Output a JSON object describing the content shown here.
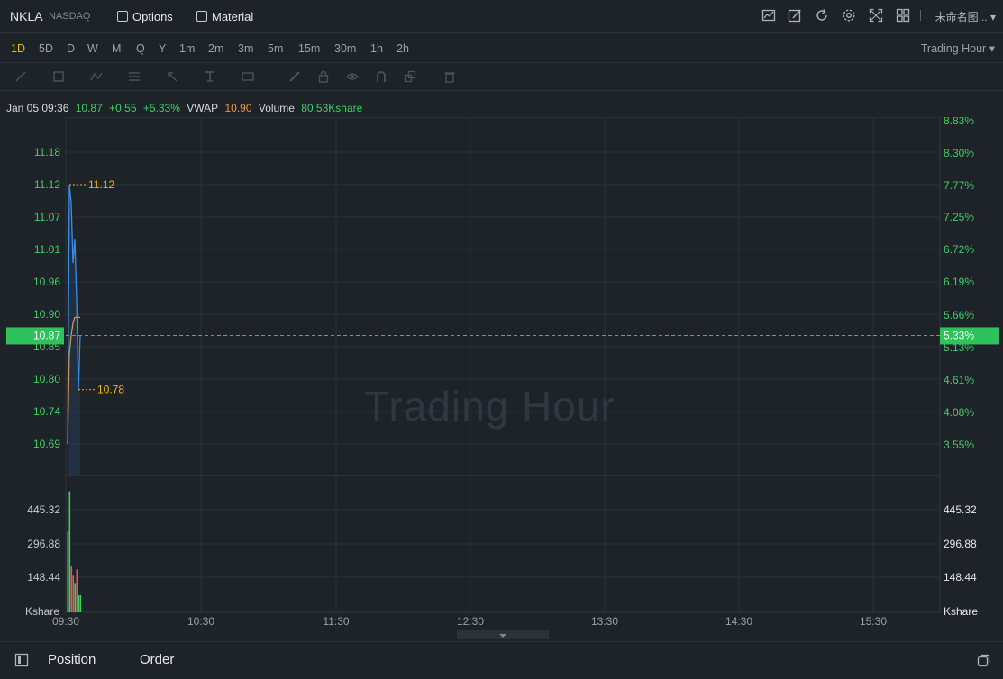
{
  "header": {
    "symbol": "NKLA",
    "exchange": "NASDAQ",
    "options_label": "Options",
    "material_label": "Material",
    "layout_name": "未命名图..."
  },
  "intervals": {
    "items": [
      "1D",
      "5D",
      "D",
      "W",
      "M",
      "Q",
      "Y",
      "1m",
      "2m",
      "3m",
      "5m",
      "15m",
      "30m",
      "1h",
      "2h"
    ],
    "active": "1D",
    "session_label": "Trading Hour"
  },
  "legend": {
    "datetime": "Jan 05 09:36",
    "price": "10.87",
    "change": "+0.55",
    "change_pct": "+5.33%",
    "vwap_label": "VWAP",
    "vwap_value": "10.90",
    "volume_label": "Volume",
    "volume_value": "80.53Kshare"
  },
  "watermark": "Trading Hour",
  "colors": {
    "up": "#3fcf63",
    "down": "#e05a5a",
    "price_line": "#3a8ee6",
    "vwap_line": "#e89a3c",
    "highlight": "#2fc25b",
    "marker": "#f0b90b"
  },
  "chart_data": {
    "type": "line",
    "price_axis_left": [
      "11.18",
      "11.12",
      "11.07",
      "11.01",
      "10.96",
      "10.90",
      "10.85",
      "10.80",
      "10.74",
      "10.69"
    ],
    "pct_axis_right": [
      "8.83%",
      "8.30%",
      "7.77%",
      "7.25%",
      "6.72%",
      "6.19%",
      "5.66%",
      "5.13%",
      "4.61%",
      "4.08%",
      "3.55%"
    ],
    "current_price_label": "10.87",
    "current_pct_label": "5.33%",
    "high_label": "11.12",
    "low_label": "10.78",
    "volume_axis": [
      "445.32",
      "296.88",
      "148.44"
    ],
    "volume_unit": "Kshare",
    "x_ticks": [
      "09:30",
      "10:30",
      "11:30",
      "12:30",
      "13:30",
      "14:30",
      "15:30"
    ],
    "ylim": [
      10.65,
      11.23
    ],
    "price": [
      {
        "t": 0,
        "v": 10.69
      },
      {
        "t": 1,
        "v": 11.12
      },
      {
        "t": 2,
        "v": 11.09
      },
      {
        "t": 3,
        "v": 10.99
      },
      {
        "t": 4,
        "v": 11.03
      },
      {
        "t": 5,
        "v": 10.93
      },
      {
        "t": 6,
        "v": 10.78
      },
      {
        "t": 7,
        "v": 10.87
      }
    ],
    "vwap": [
      {
        "t": 0,
        "v": 10.69
      },
      {
        "t": 1,
        "v": 10.84
      },
      {
        "t": 2,
        "v": 10.87
      },
      {
        "t": 3,
        "v": 10.89
      },
      {
        "t": 4,
        "v": 10.9
      },
      {
        "t": 5,
        "v": 10.9
      },
      {
        "t": 6,
        "v": 10.9
      },
      {
        "t": 7,
        "v": 10.9
      }
    ],
    "volume": [
      {
        "t": 0,
        "v": 330,
        "dir": "up"
      },
      {
        "t": 1,
        "v": 495,
        "dir": "up"
      },
      {
        "t": 2,
        "v": 190,
        "dir": "down"
      },
      {
        "t": 3,
        "v": 150,
        "dir": "down"
      },
      {
        "t": 4,
        "v": 120,
        "dir": "up"
      },
      {
        "t": 5,
        "v": 175,
        "dir": "down"
      },
      {
        "t": 6,
        "v": 70,
        "dir": "up"
      },
      {
        "t": 7,
        "v": 70,
        "dir": "up"
      }
    ],
    "volume_ylim": [
      0,
      560
    ]
  },
  "bottom": {
    "position_label": "Position",
    "order_label": "Order"
  }
}
